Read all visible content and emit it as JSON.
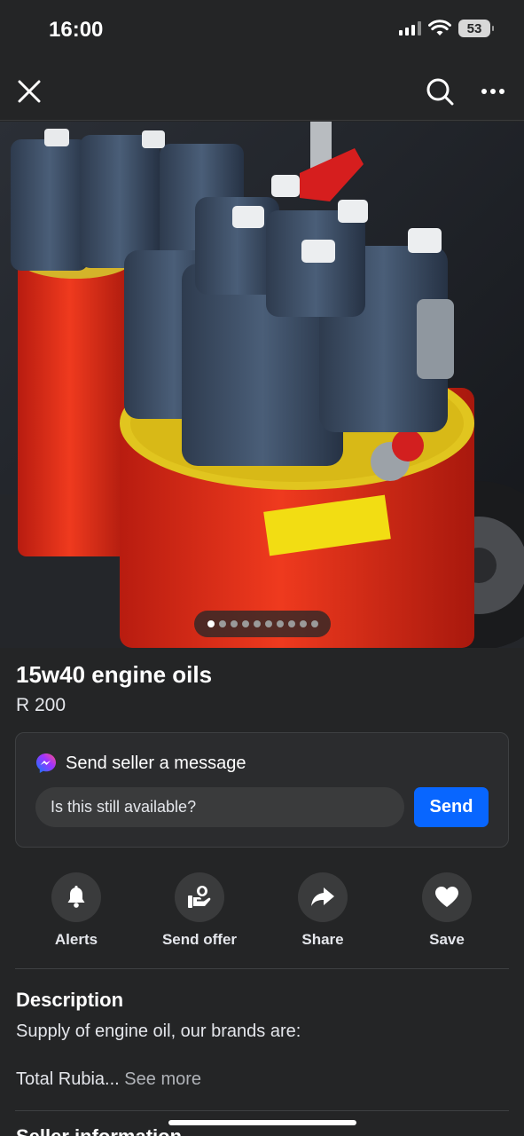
{
  "status_bar": {
    "time": "16:00",
    "battery": "53"
  },
  "listing": {
    "title": "15w40 engine oils",
    "price": "R 200",
    "photo_count": 10,
    "active_photo_index": 1
  },
  "message": {
    "heading": "Send seller a message",
    "input_value": "Is this still available?",
    "send_label": "Send"
  },
  "actions": [
    {
      "label": "Alerts",
      "icon": "bell-icon"
    },
    {
      "label": "Send offer",
      "icon": "offer-icon"
    },
    {
      "label": "Share",
      "icon": "share-icon"
    },
    {
      "label": "Save",
      "icon": "heart-icon"
    }
  ],
  "description": {
    "heading": "Description",
    "line1": "Supply of engine oil, our brands are:",
    "line2": "Total Rubia...",
    "see_more": "See more"
  },
  "next_section": {
    "heading": "Seller information"
  },
  "colors": {
    "background": "#242526",
    "accent": "#0866ff",
    "card": "#2b2c2e"
  }
}
